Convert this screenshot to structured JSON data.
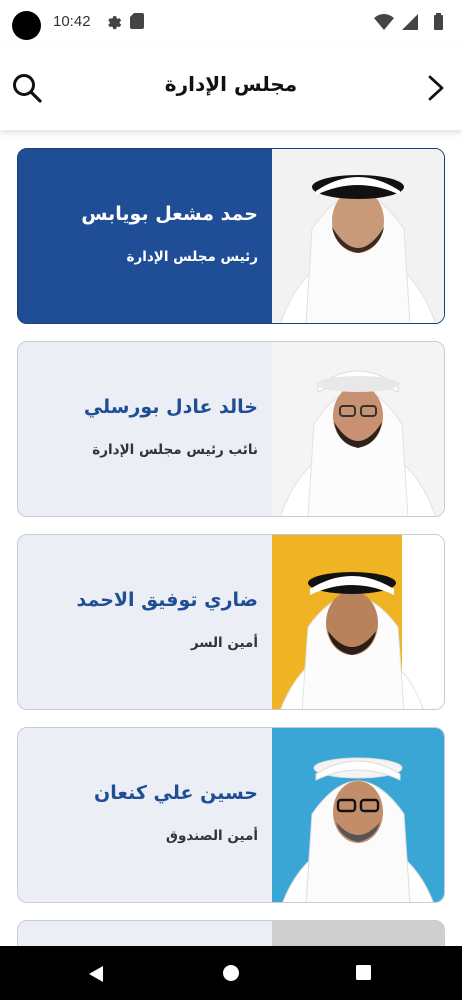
{
  "status_bar": {
    "time": "10:42",
    "icons": [
      "camera-dot",
      "settings-icon",
      "sd-card-icon",
      "wifi-icon",
      "signal-icon",
      "battery-icon"
    ]
  },
  "app_bar": {
    "title": "مجلس الإدارة",
    "search_icon": "search-icon",
    "back_icon": "chevron-right-icon"
  },
  "members": [
    {
      "name": "حمد مشعل بويابس",
      "role": "رئيس مجلس الإدارة",
      "selected": true,
      "photo_bg": "#f2f2f2"
    },
    {
      "name": "خالد عادل بورسلي",
      "role": "نائب رئيس مجلس الإدارة",
      "selected": false,
      "photo_bg": "#f2f2f2"
    },
    {
      "name": "ضاري توفيق الاحمد",
      "role": "أمين السر",
      "selected": false,
      "photo_bg": "#f0b323"
    },
    {
      "name": "حسين علي كنعان",
      "role": "أمين الصندوق",
      "selected": false,
      "photo_bg": "#3aa6d6"
    }
  ],
  "colors": {
    "accent": "#1f4e96",
    "card_bg": "#eceef6",
    "card_border": "#c9ccd6"
  },
  "nav_bar": {
    "icons": [
      "back-triangle-icon",
      "home-circle-icon",
      "recents-square-icon"
    ]
  }
}
